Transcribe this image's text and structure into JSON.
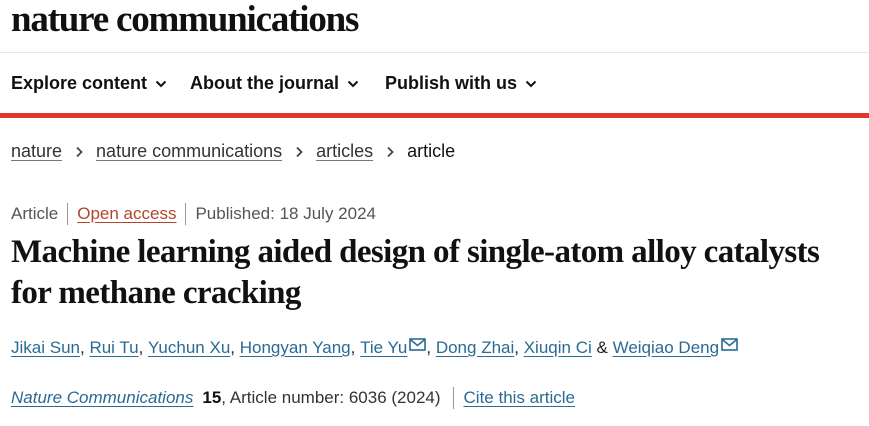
{
  "masthead": {
    "brand": "nature communications"
  },
  "nav": {
    "items": [
      {
        "label": "Explore content"
      },
      {
        "label": "About the journal"
      },
      {
        "label": "Publish with us"
      }
    ]
  },
  "breadcrumb": {
    "items": [
      "nature",
      "nature communications",
      "articles"
    ],
    "current": "article"
  },
  "meta": {
    "type": "Article",
    "access": "Open access",
    "published": "Published: 18 July 2024"
  },
  "article": {
    "title": "Machine learning aided design of single-atom alloy catalysts for methane cracking"
  },
  "authors": {
    "names": [
      "Jikai Sun",
      "Rui Tu",
      "Yuchun Xu",
      "Hongyan Yang",
      "Tie Yu",
      "Dong Zhai",
      "Xiuqin Ci",
      "Weiqiao Deng"
    ],
    "ampersand": "&"
  },
  "citation": {
    "journal": "Nature Communications",
    "volume": "15",
    "details": ", Article number: 6036 (2024)",
    "cite_label": "Cite this article"
  },
  "colors": {
    "accent_red": "#e0372a",
    "link_blue": "#2a6a94",
    "open_access": "#b2452f"
  },
  "icons": {
    "nav_dropdown": "chevron-down-icon",
    "crumb_separator": "chevron-right-icon",
    "corresponding_author": "mail-icon"
  }
}
